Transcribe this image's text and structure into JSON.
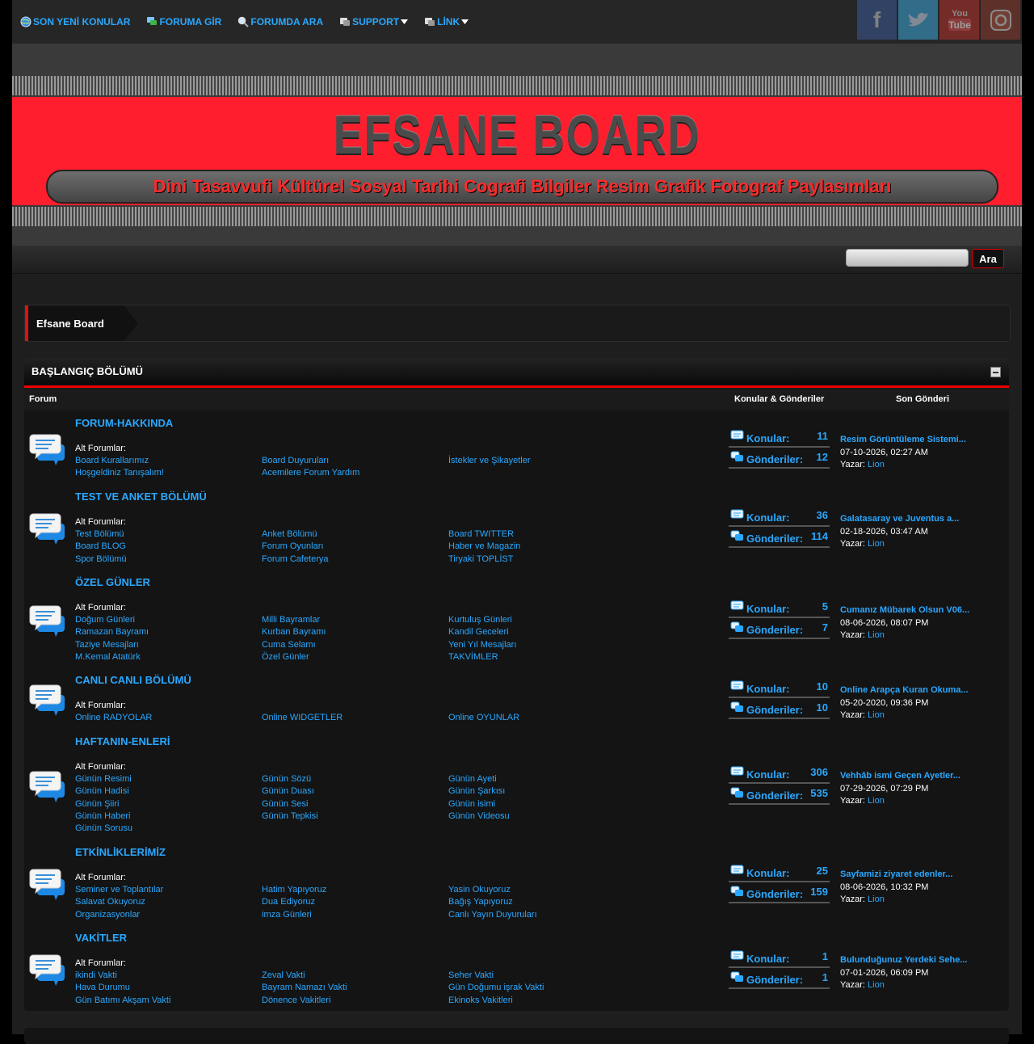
{
  "nav": [
    {
      "label": "SON YENİ KONULAR",
      "icon": "globe-icon"
    },
    {
      "label": "FORUMA GİR",
      "icon": "chat-icon"
    },
    {
      "label": "FORUMDA ARA",
      "icon": "search-icon"
    },
    {
      "label": "SUPPORT",
      "icon": "support-icon"
    },
    {
      "label": "LİNK",
      "icon": "link-icon"
    }
  ],
  "socials": [
    "facebook",
    "twitter",
    "youtube",
    "instagram"
  ],
  "header": {
    "title": "EFSANE BOARD",
    "tagline": "Dini Tasavvufi Kültürel Sosyal Tarihi Cografi Bilgiler Resim Grafik Fotograf Paylasımları"
  },
  "search": {
    "button": "Ara",
    "placeholder": ""
  },
  "breadcrumb": "Efsane Board",
  "category": {
    "title": "BAŞLANGIÇ BÖLÜMÜ",
    "col_forum": "Forum",
    "col_stats": "Konular & Gönderiler",
    "col_last": "Son Gönderi"
  },
  "labels": {
    "alt": "Alt Forumlar:",
    "topics": "Konular:",
    "posts": "Gönderiler:",
    "author": "Yazar:"
  },
  "forums": [
    {
      "title": "FORUM-HAKKINDA",
      "subs": [
        "Board Kurallarımız",
        "Board Duyuruları",
        "İstekler ve Şikayetler",
        "Hoşgeldiniz Tanışalım!",
        "Acemilere Forum Yardım"
      ],
      "topics": "11",
      "posts": "12",
      "last_title": "Resim Görüntüleme Sistemi...",
      "last_date": "07-10-2026, 02:27 AM",
      "last_author": "Lion"
    },
    {
      "title": "TEST VE ANKET BÖLÜMÜ",
      "subs": [
        "Test Bölümü",
        "Anket Bölümü",
        "Board TWITTER",
        "Board BLOG",
        "Forum Oyunları",
        "Haber ve Magazin",
        "Spor Bölümü",
        "Forum Cafeterya",
        "Tiryaki TOPLİST"
      ],
      "topics": "36",
      "posts": "114",
      "last_title": "Galatasaray ve Juventus a...",
      "last_date": "02-18-2026, 03:47 AM",
      "last_author": "Lion"
    },
    {
      "title": "ÖZEL GÜNLER",
      "subs": [
        "Doğum Günleri",
        "Milli Bayramlar",
        "Kurtuluş Günleri",
        "Ramazan Bayramı",
        "Kurban Bayramı",
        "Kandil Geceleri",
        "Taziye Mesajları",
        "Cuma Selamı",
        "Yeni Yıl Mesajları",
        "M.Kemal Atatürk",
        "Özel Günler",
        "TAKVİMLER"
      ],
      "topics": "5",
      "posts": "7",
      "last_title": "Cumanız Mübarek Olsun V06...",
      "last_date": "08-06-2026, 08:07 PM",
      "last_author": "Lion"
    },
    {
      "title": "CANLI CANLI BÖLÜMÜ",
      "subs": [
        "Online RADYOLAR",
        "Online WIDGETLER",
        "Online OYUNLAR"
      ],
      "topics": "10",
      "posts": "10",
      "last_title": "Online Arapça Kuran Okuma...",
      "last_date": "05-20-2020, 09:36 PM",
      "last_author": "Lion"
    },
    {
      "title": "HAFTANIN-ENLERİ",
      "subs": [
        "Günün Resimi",
        "Günün Sözü",
        "Günün Ayeti",
        "Günün Hadisi",
        "Günün Duası",
        "Günün Şarkısı",
        "Günün Şiiri",
        "Günün Sesi",
        "Günün isimi",
        "Günün Haberi",
        "Günün Tepkisi",
        "Günün Videosu",
        "Günün Sorusu"
      ],
      "topics": "306",
      "posts": "535",
      "last_title": "Vehhâb ismi Geçen Ayetler...",
      "last_date": "07-29-2026, 07:29 PM",
      "last_author": "Lion"
    },
    {
      "title": "ETKİNLİKLERİMİZ",
      "subs": [
        "Seminer ve Toplantılar",
        "Hatim Yapıyoruz",
        "Yasin Okuyoruz",
        "Salavat Okuyoruz",
        "Dua Ediyoruz",
        "Bağış Yapıyoruz",
        "Organizasyonlar",
        "imza Günleri",
        "Canlı Yayın Duyuruları"
      ],
      "topics": "25",
      "posts": "159",
      "last_title": "Sayfamizi ziyaret edenler...",
      "last_date": "08-06-2026, 10:32 PM",
      "last_author": "Lion"
    },
    {
      "title": "VAKİTLER",
      "subs": [
        "ikindi Vakti",
        "Zeval Vakti",
        "Seher Vakti",
        "Hava Durumu",
        "Bayram Namazı Vakti",
        "Gün Doğumu işrak Vakti",
        "Gün Batımı Akşam Vakti",
        "Dönence Vakitleri",
        "Ekinoks Vakitleri"
      ],
      "topics": "1",
      "posts": "1",
      "last_title": "Bulunduğunuz Yerdeki Sehe...",
      "last_date": "07-01-2026, 06:09 PM",
      "last_author": "Lion"
    }
  ]
}
